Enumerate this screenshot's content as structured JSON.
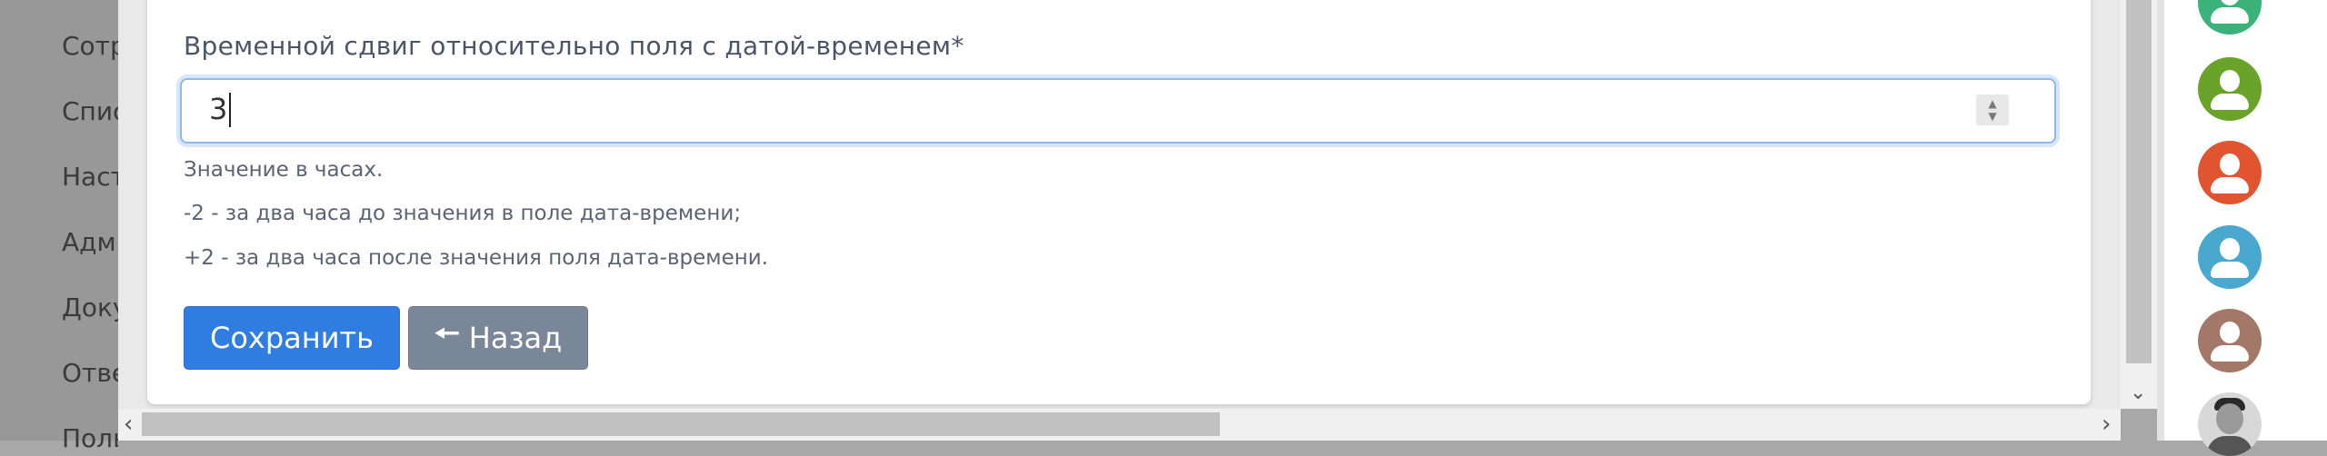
{
  "sidebar": {
    "items": [
      {
        "label": "Сотрудники"
      },
      {
        "label": "Списки"
      },
      {
        "label": "Настройки"
      },
      {
        "label": "Администрирование"
      },
      {
        "label": "Документы"
      },
      {
        "label": "Ответы"
      },
      {
        "label": "Пользователи"
      }
    ]
  },
  "form": {
    "field_label": "Временной сдвиг относительно поля с датой-временем*",
    "field_value": "3",
    "help_lines": [
      "Значение в часах.",
      "-2 - за два часа до значения в поле дата-времени;",
      "+2 - за два часа после значения поля дата-времени."
    ],
    "spin_up_icon": "chevron-up-icon",
    "spin_down_icon": "chevron-down-icon"
  },
  "buttons": {
    "save_label": "Сохранить",
    "back_label": "Назад",
    "back_icon": "arrow-left-icon"
  },
  "users_panel": {
    "avatars": [
      {
        "type": "default",
        "color": "#3bb27a"
      },
      {
        "type": "default",
        "color": "#6aa329"
      },
      {
        "type": "default",
        "color": "#e0552f"
      },
      {
        "type": "default",
        "color": "#4aa8cf"
      },
      {
        "type": "default",
        "color": "#a47869"
      },
      {
        "type": "photo",
        "color": "#d8d8d8"
      }
    ]
  },
  "colors": {
    "primary": "#2f7de1",
    "secondary": "#7a8799",
    "input_focus": "#8fb8ef"
  }
}
